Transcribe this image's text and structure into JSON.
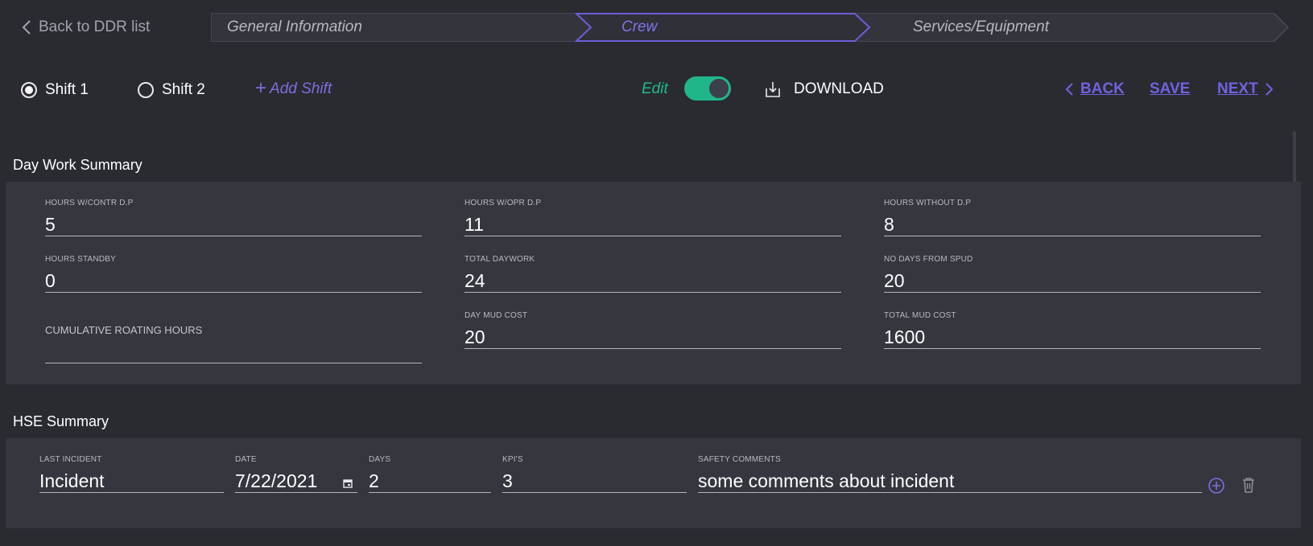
{
  "nav": {
    "back_label": "Back to DDR list",
    "steps": [
      {
        "label": "General Information",
        "state": "done"
      },
      {
        "label": "Crew",
        "state": "active"
      },
      {
        "label": "Services/Equipment",
        "state": "pending"
      }
    ]
  },
  "toolbar": {
    "shifts": [
      {
        "label": "Shift 1",
        "selected": true
      },
      {
        "label": "Shift 2",
        "selected": false
      }
    ],
    "add_shift_label": "Add Shift",
    "edit_label": "Edit",
    "edit_enabled": true,
    "download_label": "DOWNLOAD",
    "back_label": "BACK",
    "save_label": "SAVE",
    "next_label": "NEXT"
  },
  "day_work_summary": {
    "title": "Day Work Summary",
    "fields": {
      "hours_contr_dp": {
        "label": "HOURS W/CONTR D.P",
        "value": "5"
      },
      "hours_opr_dp": {
        "label": "HOURS W/OPR D.P",
        "value": "11"
      },
      "hours_without_dp": {
        "label": "HOURS WITHOUT D.P",
        "value": "8"
      },
      "hours_standby": {
        "label": "HOURS STANDBY",
        "value": "0"
      },
      "total_daywork": {
        "label": "TOTAL DAYWORK",
        "value": "24"
      },
      "days_from_spud": {
        "label": "NO DAYS FROM SPUD",
        "value": "20"
      },
      "cumulative_rotating": {
        "label": "CUMULATIVE ROATING HOURS",
        "value": ""
      },
      "day_mud_cost": {
        "label": "DAY MUD COST",
        "value": "20"
      },
      "total_mud_cost": {
        "label": "TOTAL MUD COST",
        "value": "1600"
      }
    }
  },
  "hse_summary": {
    "title": "HSE Summary",
    "columns": [
      "LAST INCIDENT",
      "DATE",
      "DAYS",
      "KPI'S",
      "SAFETY COMMENTS"
    ],
    "rows": [
      {
        "last_incident": "Incident",
        "date": "7/22/2021",
        "days": "2",
        "kpis": "3",
        "safety_comments": "some comments about incident"
      }
    ]
  },
  "colors": {
    "background": "#2a2b31",
    "panel": "#35363e",
    "accent": "#6f63e0",
    "toggle_on": "#20b68a"
  },
  "icons": [
    "chevron-left-icon",
    "download-icon",
    "chevron-right-icon",
    "calendar-icon",
    "add-circle-icon",
    "trash-icon"
  ]
}
